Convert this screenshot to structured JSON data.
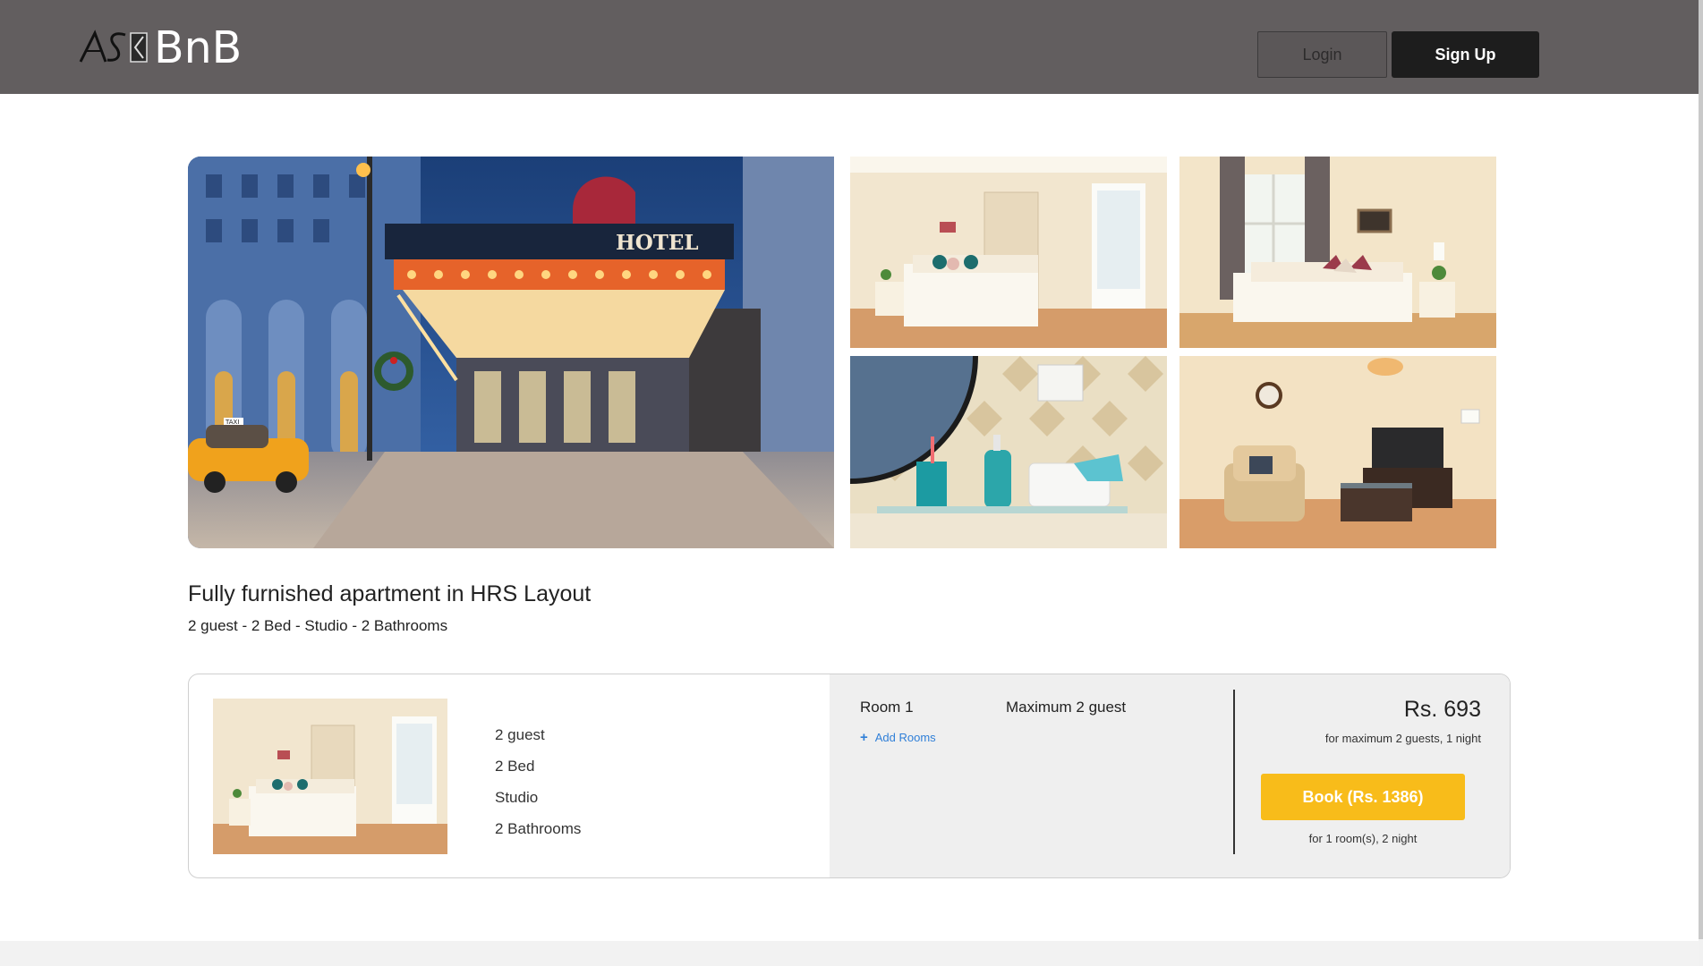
{
  "header": {
    "logo_text": "BnB",
    "login_label": "Login",
    "signup_label": "Sign Up"
  },
  "colors": {
    "header_bg": "#625e5f",
    "signup_bg": "#1d1d1d",
    "book_button": "#f8bc1a",
    "link_blue": "#2f7fd8",
    "panel_bg": "#efefef"
  },
  "gallery": {
    "main_sign_text": "HOTEL",
    "main_taxi_text": "TAXI",
    "images": [
      "hotel-entrance",
      "bedroom",
      "bedroom-window",
      "bathroom-shelf",
      "living-room"
    ]
  },
  "listing": {
    "title": "Fully furnished apartment in HRS Layout",
    "subtitle": "2 guest - 2 Bed - Studio - 2 Bathrooms"
  },
  "room_card": {
    "features": [
      "2 guest",
      "2 Bed",
      "Studio",
      "2 Bathrooms"
    ],
    "room_label": "Room 1",
    "max_guests": "Maximum 2 guest",
    "add_rooms_icon": "plus-icon",
    "add_rooms": "Add Rooms",
    "price": "Rs. 693",
    "price_note": "for maximum 2 guests, 1 night",
    "book_label": "Book (Rs. 1386)",
    "book_note": "for 1 room(s), 2 night"
  }
}
